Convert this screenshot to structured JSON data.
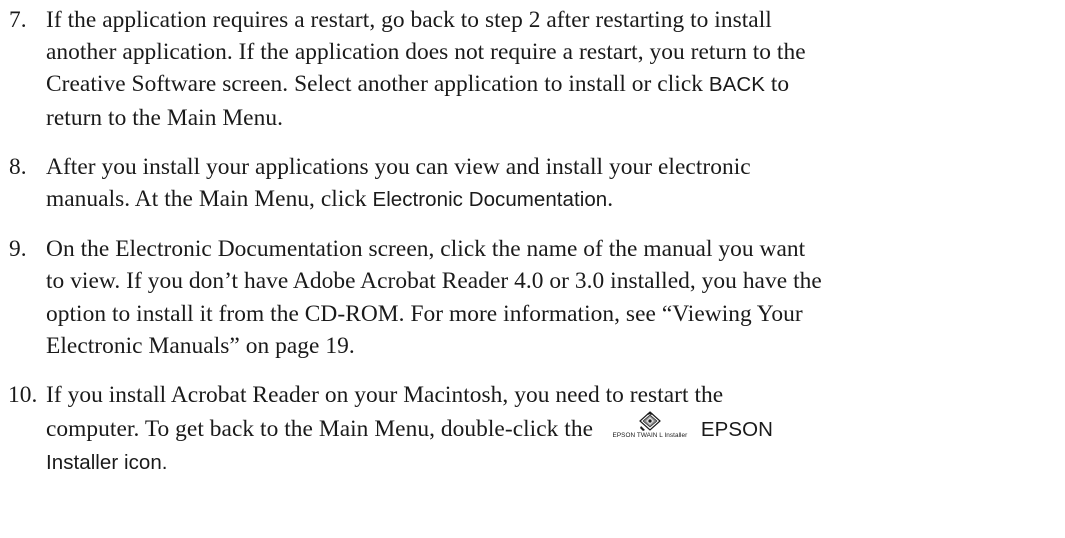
{
  "steps": [
    {
      "number": "7.",
      "lines": [
        "If the application requires a restart, go back to step 2 after restarting to install",
        "another application. If the application does not require a restart, you return to the",
        "Creative Software screen. Select another application to install or click ",
        "return to the Main Menu."
      ],
      "ui_back": "BACK",
      "after_back": " to"
    },
    {
      "number": "8.",
      "lines": [
        "After you install your applications you can view and install your electronic",
        "manuals. At the Main Menu, click "
      ],
      "ui_term": "Electronic Documentation",
      "after_term": "."
    },
    {
      "number": "9.",
      "lines": [
        "On the Electronic Documentation screen, click the name of the manual you want",
        "to view. If you don’t have Adobe Acrobat Reader 4.0 or 3.0 installed, you have the",
        "option to install it from the CD-ROM. For more information, see “Viewing Your",
        "Electronic Manuals” on page 19."
      ]
    },
    {
      "number": "10.",
      "lines": [
        "If you install Acrobat Reader on your Macintosh, you need to restart the",
        "computer. To get back to the Main Menu, double-click the "
      ],
      "icon": {
        "name": "installer-diamond-icon",
        "caption": "EPSON TWAIN L Installer"
      },
      "ui_term": "EPSON",
      "ui_term_line2": "Installer icon."
    }
  ]
}
